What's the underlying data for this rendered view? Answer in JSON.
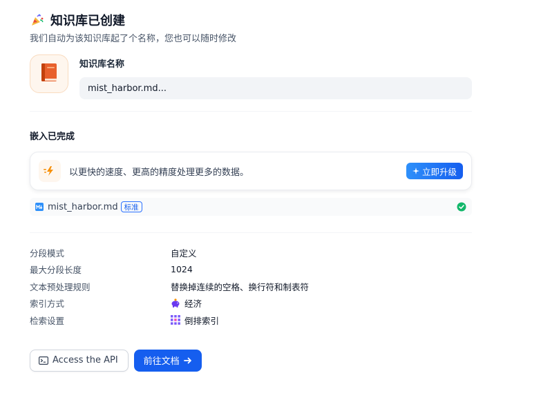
{
  "header": {
    "title": "知识库已创建",
    "subtitle": "我们自动为该知识库起了个名称，您也可以随时修改",
    "emoji_icon": "party-popper-icon"
  },
  "name_section": {
    "label": "知识库名称",
    "value": "mist_harbor.md...",
    "icon": "book-icon"
  },
  "embedding": {
    "title": "嵌入已完成",
    "upgrade_text": "以更快的速度、更高的精度处理更多的数据。",
    "upgrade_button": "立即升级",
    "file": {
      "name": "mist_harbor.md",
      "badge": "标准",
      "status_icon": "check-circle-icon"
    }
  },
  "settings": [
    {
      "key": "分段模式",
      "value": "自定义"
    },
    {
      "key": "最大分段长度",
      "value": "1024"
    },
    {
      "key": "文本预处理规则",
      "value": "替换掉连续的空格、换行符和制表符"
    },
    {
      "key": "索引方式",
      "value": "经济",
      "icon": "piggy-bank-icon"
    },
    {
      "key": "检索设置",
      "value": "倒排索引",
      "icon": "grid-index-icon"
    }
  ],
  "actions": {
    "api_button": "Access the API",
    "docs_button": "前往文档"
  },
  "colors": {
    "primary": "#155eef",
    "success": "#12b76a",
    "accent_orange": "#f79009",
    "purple": "#6938ef"
  }
}
